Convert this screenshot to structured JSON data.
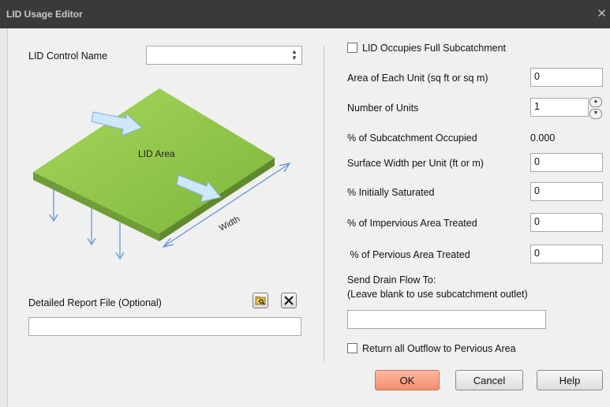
{
  "window": {
    "title": "LID Usage Editor",
    "close_glyph": "✕"
  },
  "left": {
    "control_name_label": "LID Control Name",
    "control_name_value": "",
    "diagram": {
      "area_label": "LID Area",
      "width_label": "Width"
    },
    "report_file_label": "Detailed Report File (Optional)",
    "report_file_value": "",
    "browse_icon": "folder-browse-icon",
    "clear_icon": "close-icon"
  },
  "right": {
    "full_subcatchment_label": "LID Occupies Full Subcatchment",
    "full_subcatchment_checked": false,
    "area_label": "Area of Each Unit (sq ft or sq m)",
    "area_value": "0",
    "units_label": "Number of Units",
    "units_value": "1",
    "pct_occupied_label": "% of Subcatchment Occupied",
    "pct_occupied_value": "0.000",
    "surface_width_label": "Surface Width per Unit (ft or m)",
    "surface_width_value": "0",
    "init_saturated_label": "% Initially Saturated",
    "init_saturated_value": "0",
    "impervious_label": "% of Impervious Area Treated",
    "impervious_value": "0",
    "pervious_label": " % of Pervious Area Treated",
    "pervious_value": "0",
    "drain_label_1": "Send Drain Flow To:",
    "drain_label_2": "(Leave blank to use subcatchment outlet)",
    "drain_value": "",
    "return_outflow_label": "Return all Outflow to Pervious Area",
    "return_outflow_checked": false
  },
  "buttons": {
    "ok": "OK",
    "cancel": "Cancel",
    "help": "Help"
  },
  "colors": {
    "ok_button": "#f59a7c",
    "lid_area": "#8cc63f",
    "arrow": "#5b8fd6"
  }
}
